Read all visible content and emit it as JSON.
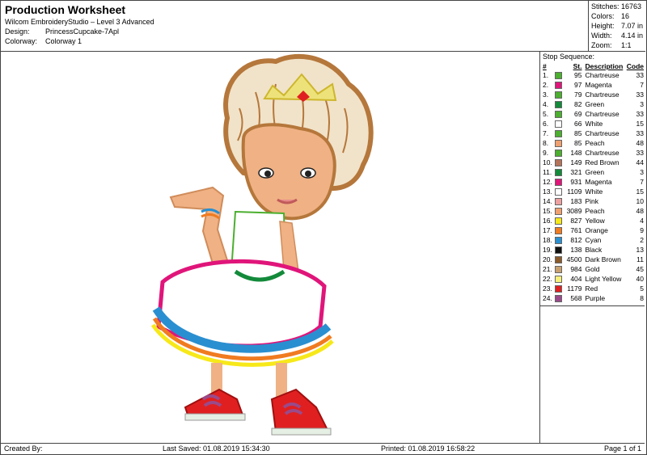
{
  "header": {
    "title": "Production Worksheet",
    "software": "Wilcom EmbroideryStudio – Level 3 Advanced",
    "design_label": "Design:",
    "design_value": "PrincessCupcake-7Apl",
    "colorway_label": "Colorway:",
    "colorway_value": "Colorway 1"
  },
  "stats": {
    "stitches_label": "Stitches:",
    "stitches_value": "16763",
    "colors_label": "Colors:",
    "colors_value": "16",
    "height_label": "Height:",
    "height_value": "7.07 in",
    "width_label": "Width:",
    "width_value": "4.14 in",
    "zoom_label": "Zoom:",
    "zoom_value": "1:1"
  },
  "stop_sequence": {
    "title": "Stop Sequence:",
    "headers": {
      "num": "#",
      "st": "St.",
      "desc": "Description",
      "code": "Code"
    },
    "rows": [
      {
        "num": "1.",
        "color": "#4caf2f",
        "st": "95",
        "desc": "Chartreuse",
        "code": "33"
      },
      {
        "num": "2.",
        "color": "#e0157a",
        "st": "97",
        "desc": "Magenta",
        "code": "7"
      },
      {
        "num": "3.",
        "color": "#4caf2f",
        "st": "79",
        "desc": "Chartreuse",
        "code": "33"
      },
      {
        "num": "4.",
        "color": "#138a3a",
        "st": "82",
        "desc": "Green",
        "code": "3"
      },
      {
        "num": "5.",
        "color": "#4caf2f",
        "st": "69",
        "desc": "Chartreuse",
        "code": "33"
      },
      {
        "num": "6.",
        "color": "#ffffff",
        "st": "66",
        "desc": "White",
        "code": "15"
      },
      {
        "num": "7.",
        "color": "#4caf2f",
        "st": "85",
        "desc": "Chartreuse",
        "code": "33"
      },
      {
        "num": "8.",
        "color": "#f0a070",
        "st": "85",
        "desc": "Peach",
        "code": "48"
      },
      {
        "num": "9.",
        "color": "#4caf2f",
        "st": "148",
        "desc": "Chartreuse",
        "code": "33"
      },
      {
        "num": "10.",
        "color": "#b5735a",
        "st": "149",
        "desc": "Red Brown",
        "code": "44"
      },
      {
        "num": "11.",
        "color": "#138a3a",
        "st": "321",
        "desc": "Green",
        "code": "3"
      },
      {
        "num": "12.",
        "color": "#e0157a",
        "st": "931",
        "desc": "Magenta",
        "code": "7"
      },
      {
        "num": "13.",
        "color": "#ffffff",
        "st": "1109",
        "desc": "White",
        "code": "15"
      },
      {
        "num": "14.",
        "color": "#eea0a0",
        "st": "183",
        "desc": "Pink",
        "code": "10"
      },
      {
        "num": "15.",
        "color": "#f0a070",
        "st": "3089",
        "desc": "Peach",
        "code": "48"
      },
      {
        "num": "16.",
        "color": "#f7e81a",
        "st": "827",
        "desc": "Yellow",
        "code": "4"
      },
      {
        "num": "17.",
        "color": "#f07b20",
        "st": "761",
        "desc": "Orange",
        "code": "9"
      },
      {
        "num": "18.",
        "color": "#2a8fd0",
        "st": "812",
        "desc": "Cyan",
        "code": "2"
      },
      {
        "num": "19.",
        "color": "#111111",
        "st": "138",
        "desc": "Black",
        "code": "13"
      },
      {
        "num": "20.",
        "color": "#8a5a2a",
        "st": "4500",
        "desc": "Dark Brown",
        "code": "11"
      },
      {
        "num": "21.",
        "color": "#c8a070",
        "st": "984",
        "desc": "Gold",
        "code": "45"
      },
      {
        "num": "22.",
        "color": "#f7f07a",
        "st": "404",
        "desc": "Light Yellow",
        "code": "40"
      },
      {
        "num": "23.",
        "color": "#e02020",
        "st": "1179",
        "desc": "Red",
        "code": "5"
      },
      {
        "num": "24.",
        "color": "#9a4a8a",
        "st": "568",
        "desc": "Purple",
        "code": "8"
      }
    ]
  },
  "footer": {
    "created_by": "Created By:",
    "last_saved": "Last Saved: 01.08.2019 15:34:30",
    "printed": "Printed: 01.08.2019 16:58:22",
    "page": "Page 1 of 1"
  }
}
